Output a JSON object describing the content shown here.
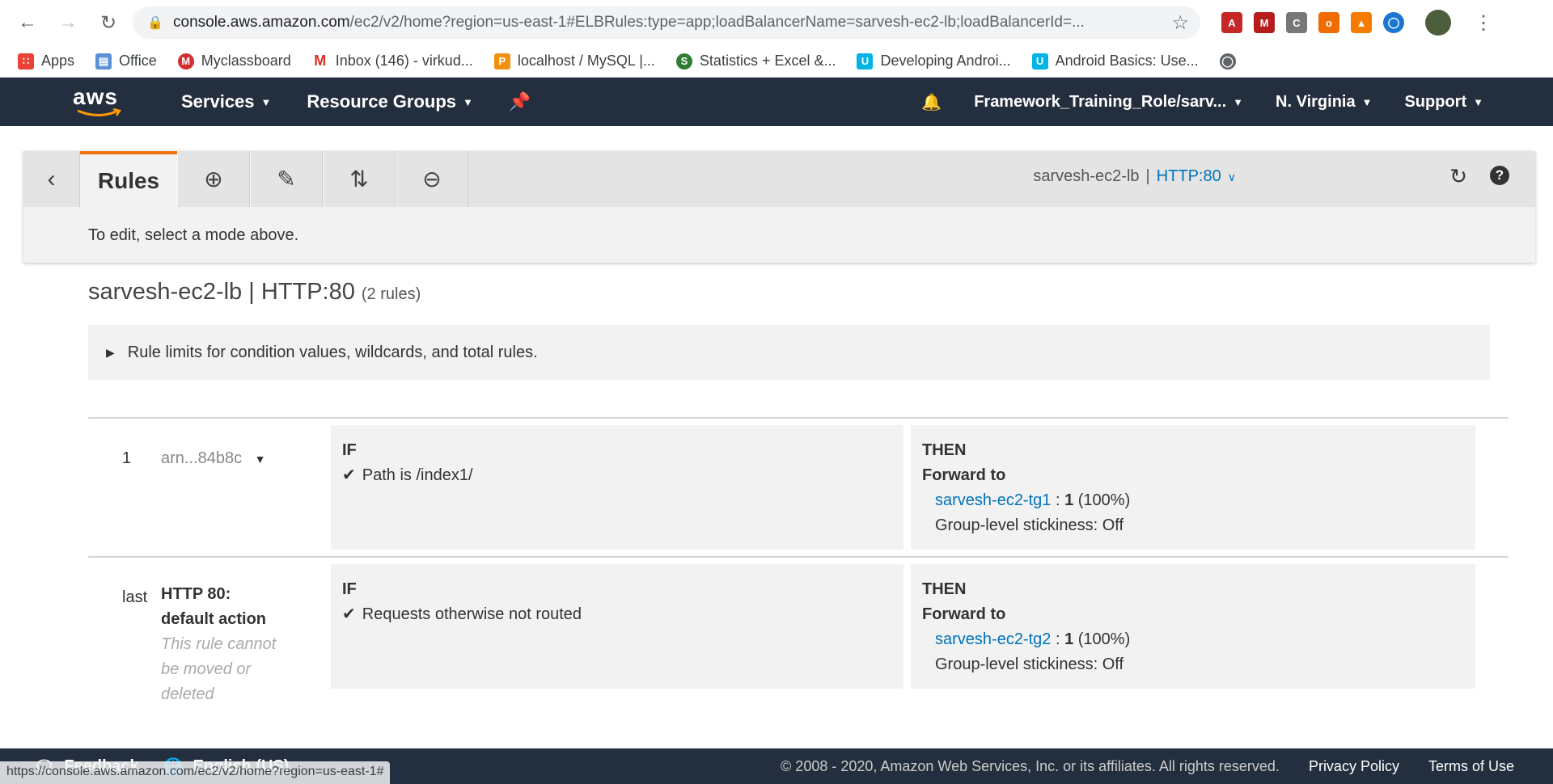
{
  "browser": {
    "url_host": "console.aws.amazon.com",
    "url_rest": "/ec2/v2/home?region=us-east-1#ELBRules:type=app;loadBalancerName=sarvesh-ec2-lb;loadBalancerId=...",
    "bookmarks": [
      {
        "label": "Apps",
        "icon": "apps-grid-icon",
        "color": "#ea4335"
      },
      {
        "label": "Office",
        "icon": "office-doc-icon",
        "color": "#5b8fd6"
      },
      {
        "label": "Myclassboard",
        "icon": "myclassboard-icon",
        "color": "#d32f2f"
      },
      {
        "label": "Inbox (146) - virkud...",
        "icon": "gmail-icon",
        "color": "#d93025"
      },
      {
        "label": "localhost / MySQL |...",
        "icon": "phpmyadmin-icon",
        "color": "#f29111"
      },
      {
        "label": "Statistics + Excel &...",
        "icon": "statistics-icon",
        "color": "#2e7d32"
      },
      {
        "label": "Developing Androi...",
        "icon": "udacity-icon",
        "color": "#02b3e4"
      },
      {
        "label": "Android Basics: Use...",
        "icon": "udacity-icon",
        "color": "#02b3e4"
      }
    ],
    "status_url": "https://console.aws.amazon.com/ec2/v2/home?region=us-east-1#"
  },
  "header": {
    "logo": "aws",
    "services": "Services",
    "resource_groups": "Resource Groups",
    "role": "Framework_Training_Role/sarv...",
    "region": "N. Virginia",
    "support": "Support"
  },
  "toolbar": {
    "tab_label": "Rules",
    "lb_name": "sarvesh-ec2-lb",
    "separator": "|",
    "listener": "HTTP:80",
    "message": "To edit, select a mode above."
  },
  "title": {
    "main": "sarvesh-ec2-lb | HTTP:80",
    "count": "(2 rules)"
  },
  "limits": {
    "label": "Rule limits for condition values, wildcards, and total rules."
  },
  "rules": [
    {
      "index": "1",
      "arn": "arn...84b8c",
      "if_label": "IF",
      "condition": "Path is  /index1/",
      "then_label": "THEN",
      "action": "Forward to",
      "target": "sarvesh-ec2-tg1",
      "weight_sep": " : ",
      "weight": "1",
      "percent": " (100%)",
      "stickiness": "Group-level stickiness: Off"
    },
    {
      "index": "last",
      "default_title": "HTTP 80: default action",
      "default_note": "This rule cannot be moved or deleted",
      "if_label": "IF",
      "condition": "Requests otherwise not routed",
      "then_label": "THEN",
      "action": "Forward to",
      "target": "sarvesh-ec2-tg2",
      "weight_sep": " : ",
      "weight": "1",
      "percent": " (100%)",
      "stickiness": "Group-level stickiness: Off"
    }
  ],
  "footer": {
    "feedback": "Feedback",
    "language": "English (US)",
    "copyright": "© 2008 - 2020, Amazon Web Services, Inc. or its affiliates. All rights reserved.",
    "privacy": "Privacy Policy",
    "terms": "Terms of Use"
  }
}
